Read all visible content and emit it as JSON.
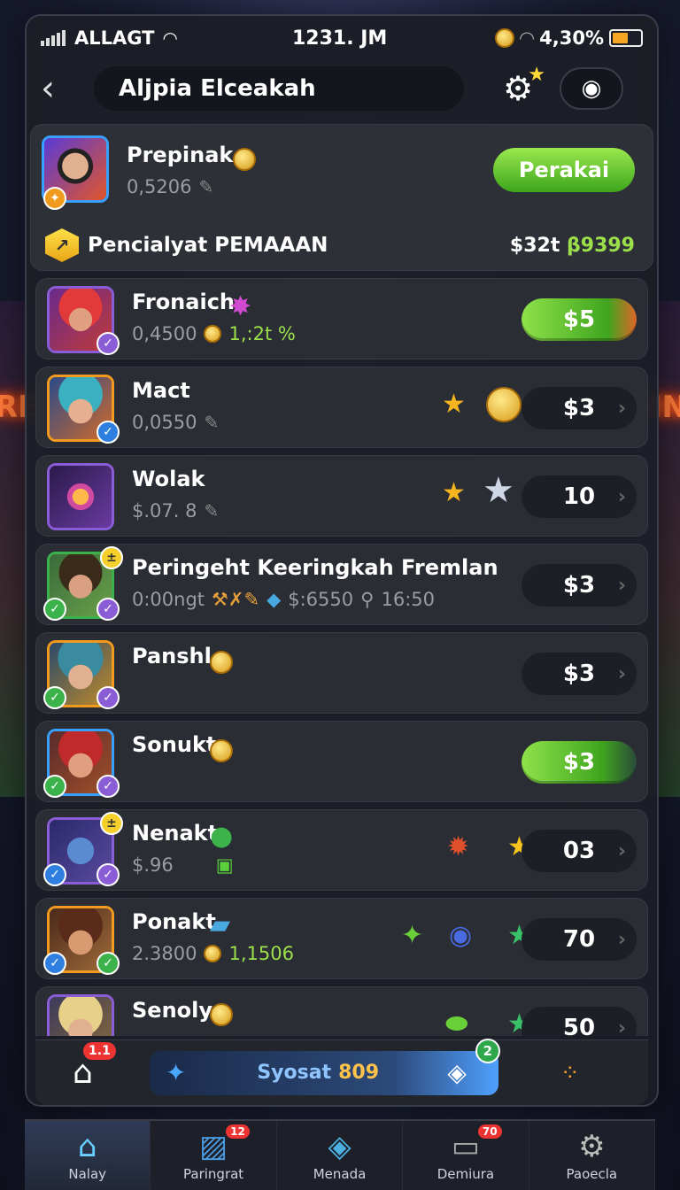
{
  "status_bar": {
    "carrier": "ALLAGT",
    "time": "1231. JM",
    "battery": "4,30%"
  },
  "header": {
    "title": "Aljpia Elceakah"
  },
  "top_card": {
    "name": "Prepinak",
    "sub": "0,5206",
    "play_label": "Perakai",
    "banner_label": "Pencialyat PEMAAAN",
    "banner_amount_prefix": "$32t",
    "banner_amount_value": "β9399"
  },
  "rows": [
    {
      "name": "Fronaich",
      "sub": "0,4500",
      "extra": "1,:2t %",
      "price": "$5",
      "price_style": "green"
    },
    {
      "name": "Mact",
      "sub": "0,0550",
      "extra": "",
      "price": "$3",
      "price_style": "dark"
    },
    {
      "name": "Wolak",
      "sub": "$.07. 8",
      "extra": "",
      "price": "10",
      "price_style": "dark"
    },
    {
      "name": "Peringeht Keeringkah Fremlan",
      "sub": "0:00ngt",
      "extra": "$:6550",
      "extra2": "16:50",
      "price": "$3",
      "price_style": "dark"
    },
    {
      "name": "Panshl",
      "sub": "",
      "extra": "",
      "price": "$3",
      "price_style": "dark"
    },
    {
      "name": "Sonukt",
      "sub": "",
      "extra": "",
      "price": "$3",
      "price_style": "green"
    },
    {
      "name": "Nenakt",
      "sub": "$.96",
      "extra": "",
      "price": "03",
      "price_style": "dark"
    },
    {
      "name": "Ponakt",
      "sub": "2.3800",
      "extra": "1,1506",
      "price": "70",
      "price_style": "dark"
    },
    {
      "name": "Senoly",
      "sub": "",
      "extra": "",
      "price": "50",
      "price_style": "dark"
    }
  ],
  "mini_bar": {
    "home_badge": "1.1",
    "label": "Syosat",
    "value": "809",
    "badge": "2"
  },
  "nav": [
    {
      "label": "Nalay",
      "icon": "home-icon",
      "badge": ""
    },
    {
      "label": "Paringrat",
      "icon": "picture-icon",
      "badge": "12"
    },
    {
      "label": "Menada",
      "icon": "box-icon",
      "badge": ""
    },
    {
      "label": "Demiura",
      "icon": "monitor-icon",
      "badge": "70"
    },
    {
      "label": "Paoecla",
      "icon": "gear-icon",
      "badge": ""
    }
  ],
  "colors": {
    "accent_green": "#6cc832",
    "accent_gold": "#f5b51e",
    "panel": "#2b2d35"
  }
}
